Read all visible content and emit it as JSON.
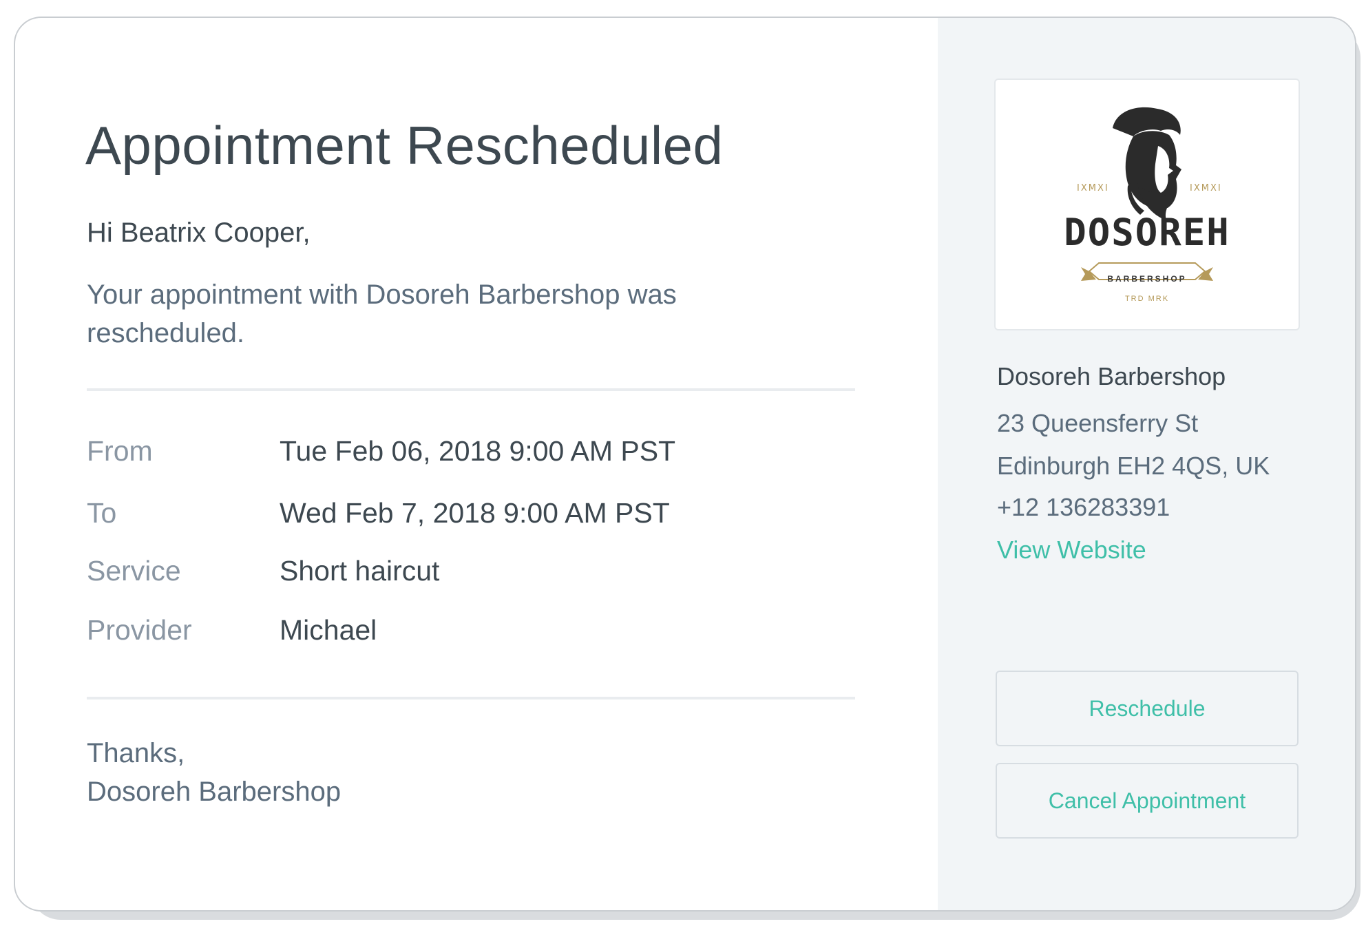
{
  "email": {
    "title": "Appointment Rescheduled",
    "greeting": "Hi Beatrix Cooper,",
    "message": "Your appointment with Dosoreh Barbershop was rescheduled.",
    "details": [
      {
        "label": "From",
        "value": "Tue Feb 06, 2018 9:00 AM PST"
      },
      {
        "label": "To",
        "value": "Wed Feb 7, 2018 9:00 AM PST"
      },
      {
        "label": "Service",
        "value": "Short haircut"
      },
      {
        "label": "Provider",
        "value": "Michael"
      }
    ],
    "signoff_line1": "Thanks,",
    "signoff_line2": "Dosoreh Barbershop"
  },
  "business": {
    "logo": {
      "wordmark": "DOSOREH",
      "roman_left": "IXMXI",
      "roman_right": "IXMXI",
      "ribbon": "BARBERSHOP",
      "trademark": "TRD MRK"
    },
    "name": "Dosoreh Barbershop",
    "address_line1": "23 Queensferry St",
    "address_line2": "Edinburgh EH2 4QS, UK",
    "phone": "+12 136283391",
    "website_label": "View Website"
  },
  "actions": {
    "reschedule_label": "Reschedule",
    "cancel_label": "Cancel Appointment"
  },
  "colors": {
    "accent": "#3fbfa8",
    "heading": "#3d4850",
    "muted_label": "#8a96a3",
    "sidebar_bg": "#f2f5f7"
  }
}
